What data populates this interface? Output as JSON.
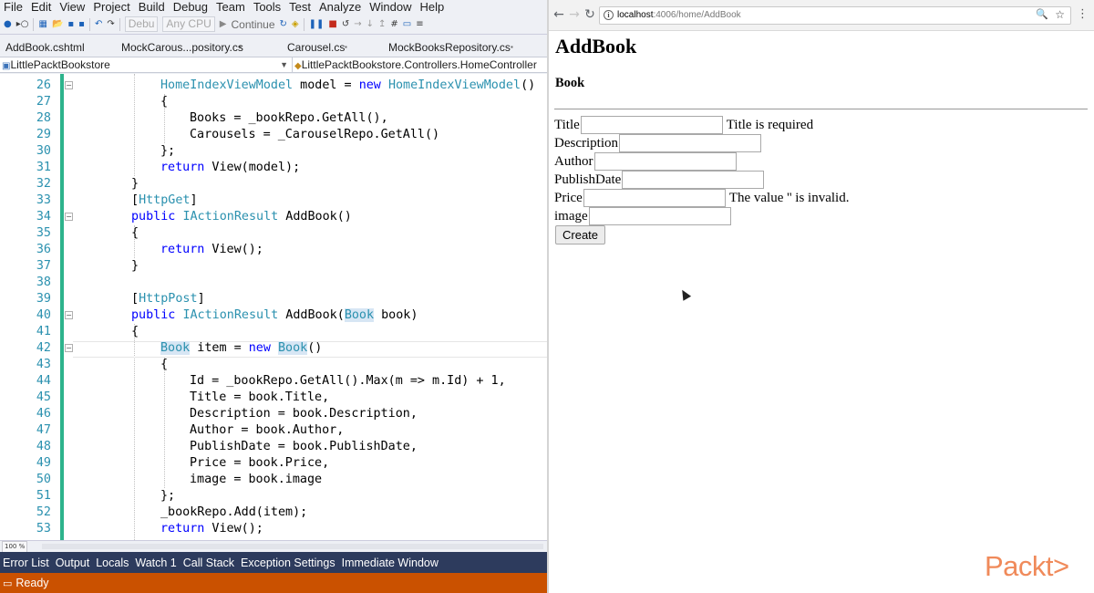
{
  "vs": {
    "menu": [
      "File",
      "Edit",
      "View",
      "Project",
      "Build",
      "Debug",
      "Team",
      "Tools",
      "Test",
      "Analyze",
      "Window",
      "Help"
    ],
    "toolbar": {
      "config": "Debu",
      "platform": "Any CPU",
      "continue_label": "Continue"
    },
    "tabs": [
      {
        "label": "AddBook.cshtml"
      },
      {
        "label": "MockCarous...pository.cs"
      },
      {
        "label": "Carousel.cs"
      },
      {
        "label": "MockBooksRepository.cs"
      }
    ],
    "navbar": {
      "project": "LittlePacktBookstore",
      "class": "LittlePacktBookstore.Controllers.HomeController"
    },
    "code_lines": [
      {
        "num": "26",
        "text": ""
      },
      {
        "num": "27",
        "text": ""
      },
      {
        "num": "28",
        "text": ""
      },
      {
        "num": "29",
        "text": ""
      },
      {
        "num": "30",
        "text": ""
      },
      {
        "num": "31",
        "text": ""
      },
      {
        "num": "32",
        "text": ""
      },
      {
        "num": "33",
        "text": ""
      },
      {
        "num": "34",
        "text": ""
      },
      {
        "num": "35",
        "text": ""
      },
      {
        "num": "36",
        "text": ""
      },
      {
        "num": "37",
        "text": ""
      },
      {
        "num": "38",
        "text": ""
      },
      {
        "num": "39",
        "text": ""
      },
      {
        "num": "40",
        "text": ""
      },
      {
        "num": "41",
        "text": ""
      },
      {
        "num": "42",
        "text": ""
      },
      {
        "num": "43",
        "text": ""
      },
      {
        "num": "44",
        "text": ""
      },
      {
        "num": "45",
        "text": ""
      },
      {
        "num": "46",
        "text": ""
      },
      {
        "num": "47",
        "text": ""
      },
      {
        "num": "48",
        "text": ""
      },
      {
        "num": "49",
        "text": ""
      },
      {
        "num": "50",
        "text": ""
      },
      {
        "num": "51",
        "text": ""
      },
      {
        "num": "52",
        "text": ""
      },
      {
        "num": "53",
        "text": ""
      }
    ],
    "code": {
      "l26a": "HomeIndexViewModel",
      "l26b": " model = ",
      "l26c": "new",
      "l26d": " ",
      "l26e": "HomeIndexViewModel",
      "l26f": "()",
      "l27": "{",
      "l28": "Books = _bookRepo.GetAll(),",
      "l29": "Carousels = _CarouselRepo.GetAll()",
      "l30": "};",
      "l31a": "return",
      "l31b": " View(model);",
      "l32": "}",
      "l33a": "[",
      "l33b": "HttpGet",
      "l33c": "]",
      "l34a": "public",
      "l34b": " ",
      "l34c": "IActionResult",
      "l34d": " AddBook()",
      "l35": "{",
      "l36a": "return",
      "l36b": " View();",
      "l37": "}",
      "l38": "",
      "l39a": "[",
      "l39b": "HttpPost",
      "l39c": "]",
      "l40a": "public",
      "l40b": " ",
      "l40c": "IActionResult",
      "l40d": " AddBook(",
      "l40e": "Book",
      "l40f": " book)",
      "l41": "{",
      "l42a": "Book",
      "l42b": " item = ",
      "l42c": "new",
      "l42d": " ",
      "l42e": "Book",
      "l42f": "()",
      "l43": "{",
      "l44": "Id = _bookRepo.GetAll().Max(m => m.Id) + 1,",
      "l45": "Title = book.Title,",
      "l46": "Description = book.Description,",
      "l47": "Author = book.Author,",
      "l48": "PublishDate = book.PublishDate,",
      "l49": "Price = book.Price,",
      "l50": "image = book.image",
      "l51": "};",
      "l52": "_bookRepo.Add(item);",
      "l53a": "return",
      "l53b": " View();"
    },
    "zoom": "100 %",
    "bottom_tabs": [
      "Error List",
      "Output",
      "Locals",
      "Watch 1",
      "Call Stack",
      "Exception Settings",
      "Immediate Window"
    ],
    "status": "Ready",
    "colors": {
      "status_bar": "#ca5100",
      "bottom_tabs": "#2d3b5d",
      "line_numbers": "#2b91af",
      "keyword": "#0000ff",
      "type": "#2b91af"
    }
  },
  "browser": {
    "url_host": "localhost",
    "url_path": ":4006/home/AddBook",
    "page": {
      "title": "AddBook",
      "subtitle": "Book",
      "fields": [
        {
          "label": "Title",
          "value": "",
          "error": "Title is required"
        },
        {
          "label": "Description",
          "value": "",
          "error": ""
        },
        {
          "label": "Author",
          "value": "",
          "error": ""
        },
        {
          "label": "PublishDate",
          "value": "",
          "error": ""
        },
        {
          "label": "Price",
          "value": "",
          "error": "The value '' is invalid."
        },
        {
          "label": "image",
          "value": "",
          "error": ""
        }
      ],
      "create_label": "Create"
    }
  },
  "watermark": "Packt>",
  "icons": {
    "back": "arrow-left-icon",
    "forward": "arrow-right-icon",
    "reload": "reload-icon",
    "info": "info-icon",
    "zoom": "magnifier-icon",
    "bookmark": "star-icon",
    "menu": "kebab-menu-icon"
  }
}
